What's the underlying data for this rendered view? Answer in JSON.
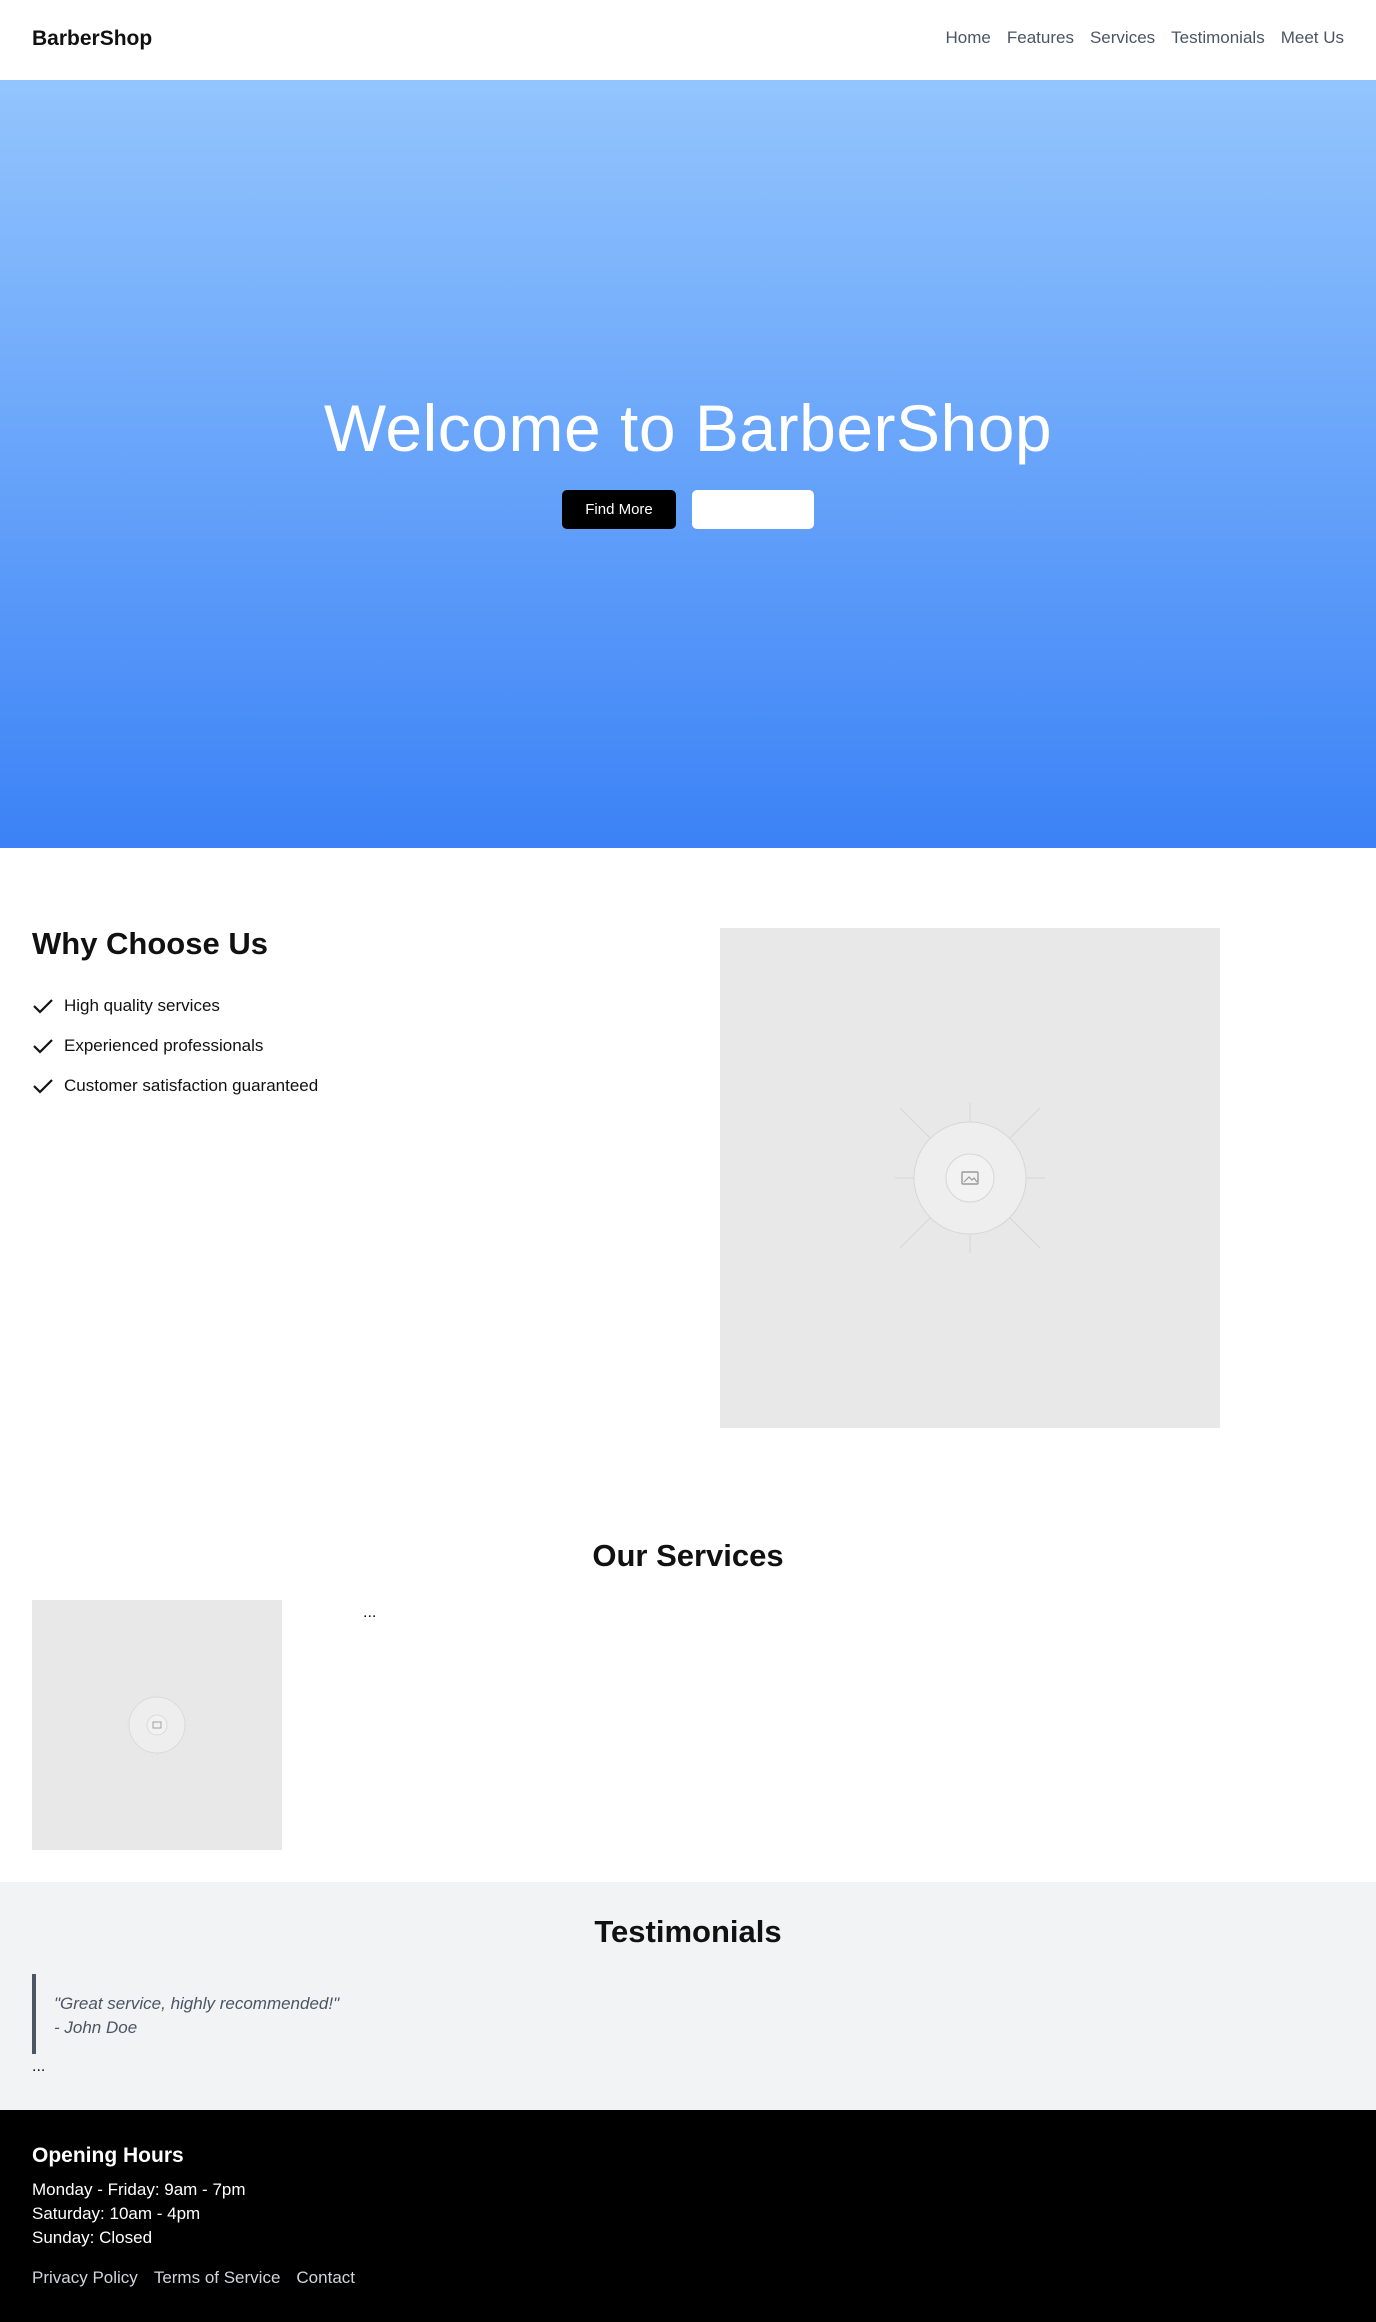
{
  "nav": {
    "brand": "BarberShop",
    "links": [
      "Home",
      "Features",
      "Services",
      "Testimonials",
      "Meet Us"
    ]
  },
  "hero": {
    "title": "Welcome to BarberShop",
    "primary_button": "Find More",
    "secondary_button": ""
  },
  "why": {
    "title": "Why Choose Us",
    "items": [
      "High quality services",
      "Experienced professionals",
      "Customer satisfaction guaranteed"
    ]
  },
  "services": {
    "title": "Our Services",
    "more": "..."
  },
  "testimonials": {
    "title": "Testimonials",
    "quote": "\"Great service, highly recommended!\"",
    "author": "- John Doe",
    "more": "..."
  },
  "footer": {
    "hours_title": "Opening Hours",
    "hours": [
      "Monday - Friday: 9am - 7pm",
      "Saturday: 10am - 4pm",
      "Sunday: Closed"
    ],
    "links": [
      "Privacy Policy",
      "Terms of Service",
      "Contact"
    ]
  },
  "colors": {
    "hero_gradient_top": "#93c5fd",
    "hero_gradient_bottom": "#3b82f6",
    "footer_bg": "#000000",
    "testimonials_bg": "#f2f3f5"
  },
  "icons": [
    "check-icon",
    "image-placeholder-icon"
  ]
}
